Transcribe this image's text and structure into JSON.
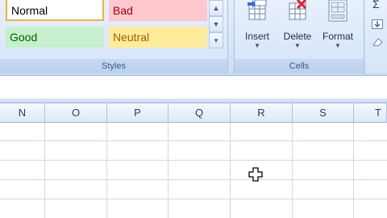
{
  "styles_group": {
    "tiles": {
      "normal": "Normal",
      "bad": "Bad",
      "good": "Good",
      "neutral": "Neutral"
    },
    "label": "Styles"
  },
  "cells_group": {
    "buttons": {
      "insert": "Insert",
      "delete": "Delete",
      "format": "Format"
    },
    "label": "Cells"
  },
  "right_strip": {
    "sigma": "Σ"
  },
  "columns": [
    "N",
    "O",
    "P",
    "Q",
    "R",
    "S",
    "T"
  ],
  "colors": {
    "ribbon": "#d6e5f8",
    "bad_fill": "#ffc7ce",
    "good_fill": "#c6efce",
    "neutral_fill": "#ffeb9c",
    "gridline": "#d0d7e5"
  }
}
